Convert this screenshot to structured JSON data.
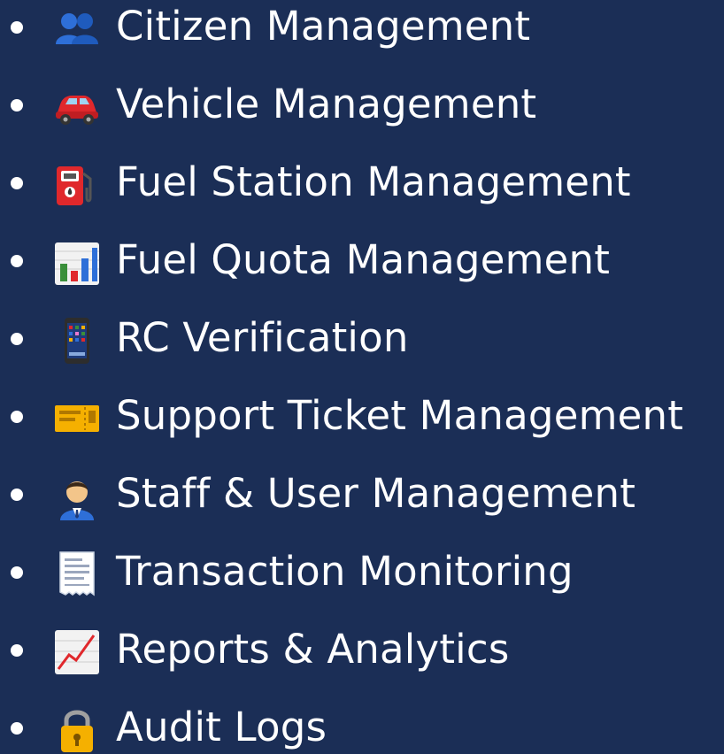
{
  "colors": {
    "background": "#1b2e56",
    "text": "#ffffff"
  },
  "features": [
    {
      "icon": "people-icon",
      "label": "Citizen Management"
    },
    {
      "icon": "car-icon",
      "label": "Vehicle Management"
    },
    {
      "icon": "fuel-pump-icon",
      "label": "Fuel Station Management"
    },
    {
      "icon": "bar-chart-icon",
      "label": "Fuel Quota Management"
    },
    {
      "icon": "mobile-phone-icon",
      "label": "RC Verification"
    },
    {
      "icon": "ticket-icon",
      "label": "Support Ticket Management"
    },
    {
      "icon": "office-worker-icon",
      "label": "Staff & User Management"
    },
    {
      "icon": "receipt-icon",
      "label": "Transaction Monitoring"
    },
    {
      "icon": "trend-chart-icon",
      "label": "Reports & Analytics"
    },
    {
      "icon": "lock-icon",
      "label": "Audit Logs"
    }
  ]
}
